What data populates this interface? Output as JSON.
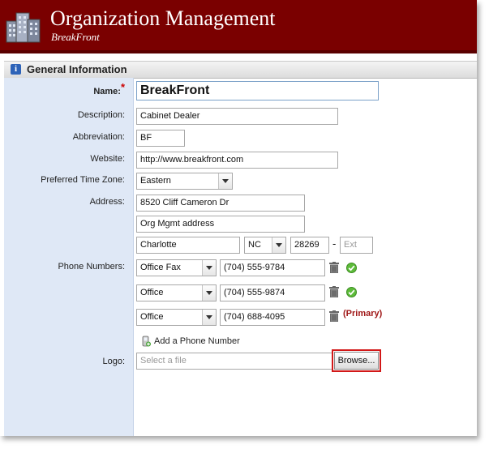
{
  "header": {
    "title": "Organization Management",
    "subtitle": "BreakFront",
    "bg_color": "#7a0000"
  },
  "section": {
    "title": "General Information",
    "icon": "info-icon"
  },
  "form": {
    "name": {
      "label": "Name:",
      "required_mark": "*",
      "value": "BreakFront"
    },
    "description": {
      "label": "Description:",
      "value": "Cabinet Dealer"
    },
    "abbreviation": {
      "label": "Abbreviation:",
      "value": "BF"
    },
    "website": {
      "label": "Website:",
      "value": "http://www.breakfront.com"
    },
    "timezone": {
      "label": "Preferred Time Zone:",
      "value": "Eastern"
    },
    "address": {
      "label": "Address:",
      "line1": "8520  Cliff Cameron Dr",
      "line2": "Org Mgmt address",
      "city": "Charlotte",
      "state": "NC",
      "zip": "28269",
      "dash": "-",
      "ext_placeholder": "Ext"
    },
    "phones": {
      "label": "Phone Numbers:",
      "items": [
        {
          "type": "Office Fax",
          "number": "(704) 555-9784",
          "status": "check"
        },
        {
          "type": "Office",
          "number": "(704) 555-9874",
          "status": "check"
        },
        {
          "type": "Office",
          "number": "(704) 688-4095",
          "status": "primary"
        }
      ],
      "primary_label": "(Primary)",
      "add_label": "Add a Phone Number"
    },
    "logo": {
      "label": "Logo:",
      "placeholder": "Select a file",
      "browse_label": "Browse..."
    }
  },
  "colors": {
    "accent": "#7a0000",
    "primary_text": "#a01818",
    "highlight": "#d21818"
  }
}
